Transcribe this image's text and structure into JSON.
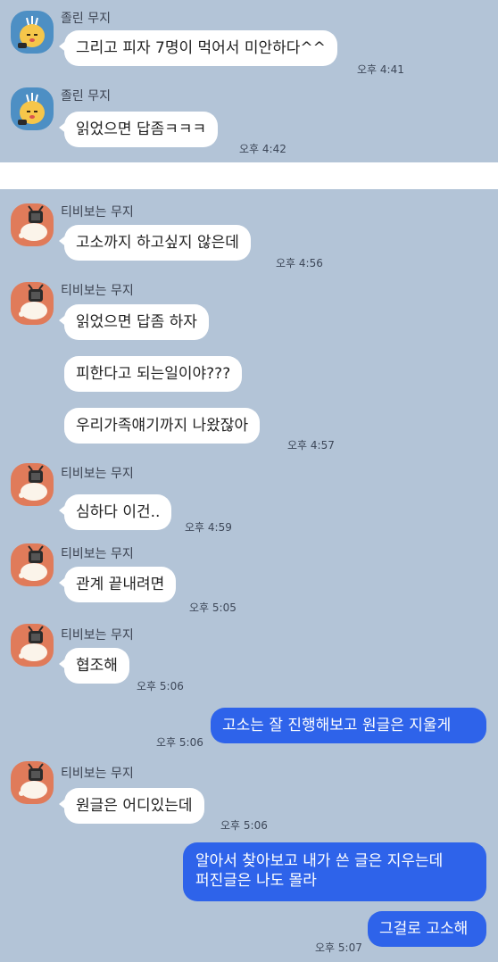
{
  "senders": {
    "sleepy": "졸린 무지",
    "tv": "티비보는 무지"
  },
  "top_messages": [
    {
      "text": "그리고 피자 7명이 먹어서 미안하다^^",
      "time": "오후 4:41"
    },
    {
      "text": "읽었으면 답좀ㅋㅋㅋ",
      "time": "오후 4:42"
    }
  ],
  "bottom_messages": {
    "m1": {
      "text": "고소까지 하고싶지 않은데",
      "time": "오후 4:56"
    },
    "m2": {
      "text": "읽었으면 답좀 하자"
    },
    "m3": {
      "text": "피한다고 되는일이야???"
    },
    "m4": {
      "text": "우리가족얘기까지 나왔잖아",
      "time": "오후 4:57"
    },
    "m5": {
      "text": "심하다 이건..",
      "time": "오후 4:59"
    },
    "m6": {
      "text": "관계 끝내려면",
      "time": "오후 5:05"
    },
    "m7": {
      "text": "협조해",
      "time": "오후 5:06"
    },
    "me1": {
      "text": "고소는 잘 진행해보고 원글은 지울게",
      "time": "오후 5:06"
    },
    "m8": {
      "text": "원글은 어디있는데",
      "time": "오후 5:06"
    },
    "me2": {
      "line1": "알아서 찾아보고 내가 쓴 글은 지우는데",
      "line2": "퍼진글은 나도 몰라"
    },
    "me3": {
      "text": "그걸로 고소해",
      "time": "오후 5:07"
    }
  },
  "colors": {
    "background": "#b3c4d7",
    "incoming_bubble": "#ffffff",
    "outgoing_bubble": "#2e63ea",
    "avatar_sleepy": "#4d8fc4",
    "avatar_tv": "#e07b5a"
  },
  "icons": {
    "sleepy_avatar": "muzi-sleepy-avatar-icon",
    "tv_avatar": "muzi-tv-avatar-icon"
  }
}
